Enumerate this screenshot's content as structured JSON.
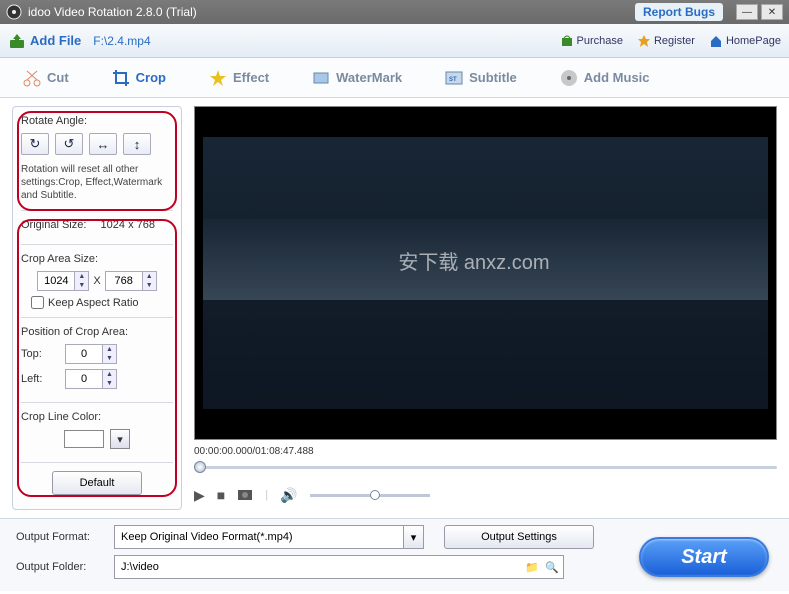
{
  "titlebar": {
    "title": "idoo Video Rotation 2.8.0 (Trial)",
    "report": "Report Bugs"
  },
  "toolbar1": {
    "addfile": "Add File",
    "filepath": "F:\\2.4.mp4",
    "purchase": "Purchase",
    "register": "Register",
    "homepage": "HomePage"
  },
  "tabs": {
    "cut": "Cut",
    "crop": "Crop",
    "effect": "Effect",
    "watermark": "WaterMark",
    "subtitle": "Subtitle",
    "addmusic": "Add Music"
  },
  "rotate": {
    "label": "Rotate Angle:",
    "note": "Rotation will reset all other settings:Crop, Effect,Watermark and Subtitle."
  },
  "crop": {
    "original_label": "Original Size:",
    "original_value": "1024 x 768",
    "area_label": "Crop Area Size:",
    "w": "1024",
    "h": "768",
    "x_sep": "X",
    "keep_ratio": "Keep Aspect Ratio",
    "pos_label": "Position of Crop Area:",
    "top_label": "Top:",
    "top_val": "0",
    "left_label": "Left:",
    "left_val": "0",
    "color_label": "Crop Line Color:",
    "default_btn": "Default"
  },
  "annotations": {
    "rotate": "Rotate",
    "crop": "Crop"
  },
  "player": {
    "time_current": "00:00:00.000",
    "time_sep": " / ",
    "time_total": "01:08:47.488",
    "watermark_text": "安下载\nanxz.com"
  },
  "output": {
    "format_label": "Output Format:",
    "format_value": "Keep Original Video Format(*.mp4)",
    "settings_btn": "Output Settings",
    "folder_label": "Output Folder:",
    "folder_value": "J:\\video",
    "start": "Start"
  }
}
